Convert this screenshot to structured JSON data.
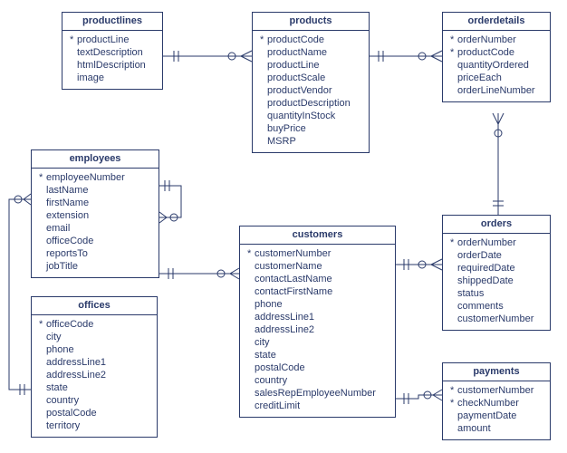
{
  "entities": {
    "productlines": {
      "title": "productlines",
      "fields": [
        {
          "pk": true,
          "name": "productLine"
        },
        {
          "pk": false,
          "name": "textDescription"
        },
        {
          "pk": false,
          "name": "htmlDescription"
        },
        {
          "pk": false,
          "name": "image"
        }
      ]
    },
    "products": {
      "title": "products",
      "fields": [
        {
          "pk": true,
          "name": "productCode"
        },
        {
          "pk": false,
          "name": "productName"
        },
        {
          "pk": false,
          "name": "productLine"
        },
        {
          "pk": false,
          "name": "productScale"
        },
        {
          "pk": false,
          "name": "productVendor"
        },
        {
          "pk": false,
          "name": "productDescription"
        },
        {
          "pk": false,
          "name": "quantityInStock"
        },
        {
          "pk": false,
          "name": "buyPrice"
        },
        {
          "pk": false,
          "name": "MSRP"
        }
      ]
    },
    "orderdetails": {
      "title": "orderdetails",
      "fields": [
        {
          "pk": true,
          "name": "orderNumber"
        },
        {
          "pk": true,
          "name": "productCode"
        },
        {
          "pk": false,
          "name": "quantityOrdered"
        },
        {
          "pk": false,
          "name": "priceEach"
        },
        {
          "pk": false,
          "name": "orderLineNumber"
        }
      ]
    },
    "employees": {
      "title": "employees",
      "fields": [
        {
          "pk": true,
          "name": "employeeNumber"
        },
        {
          "pk": false,
          "name": "lastName"
        },
        {
          "pk": false,
          "name": "firstName"
        },
        {
          "pk": false,
          "name": "extension"
        },
        {
          "pk": false,
          "name": "email"
        },
        {
          "pk": false,
          "name": "officeCode"
        },
        {
          "pk": false,
          "name": "reportsTo"
        },
        {
          "pk": false,
          "name": "jobTitle"
        }
      ]
    },
    "offices": {
      "title": "offices",
      "fields": [
        {
          "pk": true,
          "name": "officeCode"
        },
        {
          "pk": false,
          "name": "city"
        },
        {
          "pk": false,
          "name": "phone"
        },
        {
          "pk": false,
          "name": "addressLine1"
        },
        {
          "pk": false,
          "name": "addressLine2"
        },
        {
          "pk": false,
          "name": "state"
        },
        {
          "pk": false,
          "name": "country"
        },
        {
          "pk": false,
          "name": "postalCode"
        },
        {
          "pk": false,
          "name": "territory"
        }
      ]
    },
    "customers": {
      "title": "customers",
      "fields": [
        {
          "pk": true,
          "name": "customerNumber"
        },
        {
          "pk": false,
          "name": "customerName"
        },
        {
          "pk": false,
          "name": "contactLastName"
        },
        {
          "pk": false,
          "name": "contactFirstName"
        },
        {
          "pk": false,
          "name": "phone"
        },
        {
          "pk": false,
          "name": "addressLine1"
        },
        {
          "pk": false,
          "name": "addressLine2"
        },
        {
          "pk": false,
          "name": "city"
        },
        {
          "pk": false,
          "name": "state"
        },
        {
          "pk": false,
          "name": "postalCode"
        },
        {
          "pk": false,
          "name": "country"
        },
        {
          "pk": false,
          "name": "salesRepEmployeeNumber"
        },
        {
          "pk": false,
          "name": "creditLimit"
        }
      ]
    },
    "orders": {
      "title": "orders",
      "fields": [
        {
          "pk": true,
          "name": "orderNumber"
        },
        {
          "pk": false,
          "name": "orderDate"
        },
        {
          "pk": false,
          "name": "requiredDate"
        },
        {
          "pk": false,
          "name": "shippedDate"
        },
        {
          "pk": false,
          "name": "status"
        },
        {
          "pk": false,
          "name": "comments"
        },
        {
          "pk": false,
          "name": "customerNumber"
        }
      ]
    },
    "payments": {
      "title": "payments",
      "fields": [
        {
          "pk": true,
          "name": "customerNumber"
        },
        {
          "pk": true,
          "name": "checkNumber"
        },
        {
          "pk": false,
          "name": "paymentDate"
        },
        {
          "pk": false,
          "name": "amount"
        }
      ]
    }
  }
}
